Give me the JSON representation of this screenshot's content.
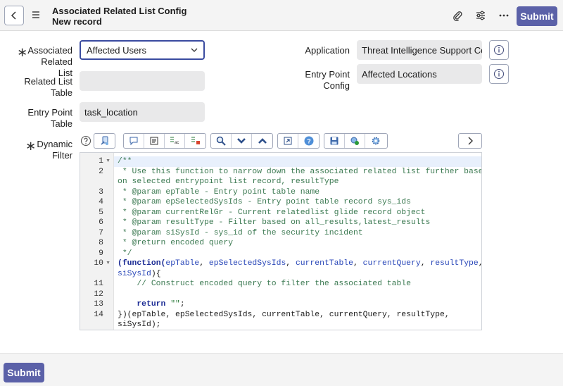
{
  "header": {
    "title": "Associated Related List Config",
    "subtitle": "New record",
    "submit_label": "Submit"
  },
  "form": {
    "associated_related_list": {
      "label_line1": "Associated",
      "label_line2": "Related List",
      "value": "Affected Users"
    },
    "related_list_table": {
      "label_line1": "Related List",
      "label_line2": "Table",
      "value": ""
    },
    "entry_point_table": {
      "label_line1": "Entry Point",
      "label_line2": "Table",
      "value": "task_location"
    },
    "dynamic_filter": {
      "label_line1": "Dynamic",
      "label_line2": "Filter"
    },
    "application": {
      "label": "Application",
      "value": "Threat Intelligence Support Cc"
    },
    "entry_point_config": {
      "label_line1": "Entry Point",
      "label_line2": "Config",
      "value": "Affected Locations"
    }
  },
  "editor": {
    "line_numbers": [
      "1",
      "2",
      "3",
      "4",
      "5",
      "6",
      "7",
      "8",
      "9",
      "10",
      "11",
      "12",
      "13",
      "14"
    ],
    "code": {
      "l1": "/**",
      "l2a": " * Use this function to narrow down the associated related list further based",
      "l2b": "on selected entrypoint list record, resultType",
      "l3": " * @param epTable - Entry point table name",
      "l4": " * @param epSelectedSysIds - Entry point table record sys_ids",
      "l5": " * @param currentRelGr - Current relatedlist glide record object",
      "l6": " * @param resultType - Filter based on all_results,latest_results",
      "l7": " * @param siSysId - sys_id of the security incident",
      "l8": " * @return encoded query",
      "l9": " */",
      "l10_open": "(",
      "l10_kw": "function",
      "l10_p1": "(",
      "l10_a1": "epTable",
      "l10_comma": ", ",
      "l10_a2": "epSelectedSysIds",
      "l10_a3": "currentTable",
      "l10_a4": "currentQuery",
      "l10_a5": "resultType",
      "l10b_a6": "siSysId",
      "l10b_close": "){",
      "l11": "    // Construct encoded query to filter the associated table",
      "l13_indent": "    ",
      "l13_kw": "return",
      "l13_sp": " ",
      "l13_str": "\"\"",
      "l13_semi": ";",
      "l14a": "})(epTable, epSelectedSysIds, currentTable, currentQuery, resultType,",
      "l14b": "siSysId);"
    }
  },
  "colors": {
    "primary": "#5b61a8",
    "focus_border": "#3a4ba0",
    "field_bg": "#e9e9ea",
    "comment": "#3c7a52",
    "keyword": "#1b2b94"
  }
}
